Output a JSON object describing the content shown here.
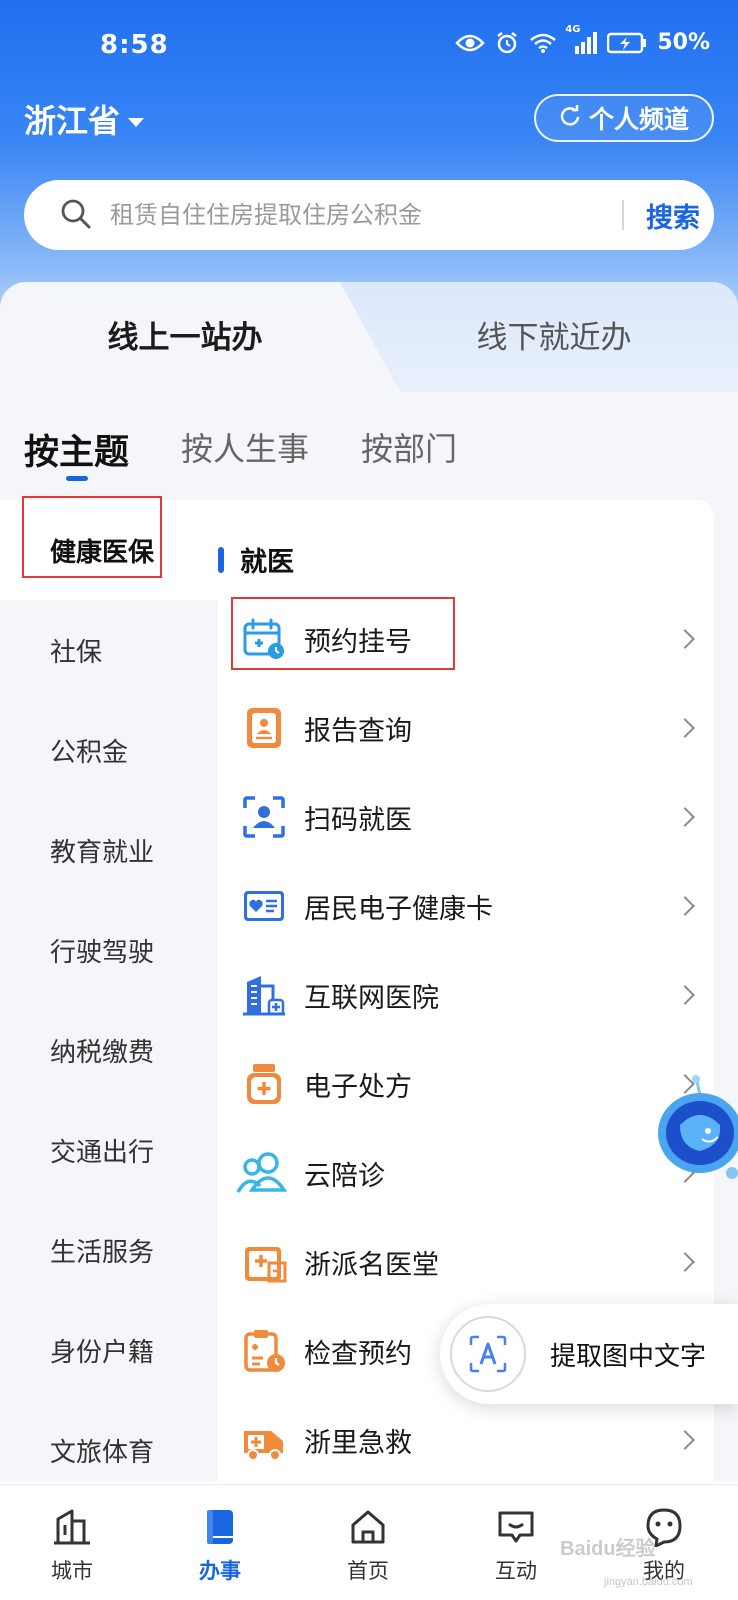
{
  "status_bar": {
    "time": "8:58",
    "network": "4G",
    "battery": "50%"
  },
  "header": {
    "province": "浙江省",
    "personal_channel": "个人频道"
  },
  "search": {
    "placeholder": "租赁自住住房提取住房公积金",
    "button": "搜索"
  },
  "mode_tabs": {
    "online": "线上一站办",
    "offline": "线下就近办",
    "selected": "线上一站办"
  },
  "sub_tabs": {
    "items": [
      "按主题",
      "按人生事",
      "按部门"
    ],
    "selected": "按主题"
  },
  "side_nav": {
    "items": [
      "健康医保",
      "社保",
      "公积金",
      "教育就业",
      "行驶驾驶",
      "纳税缴费",
      "交通出行",
      "生活服务",
      "身份户籍",
      "文旅体育"
    ],
    "selected": "健康医保"
  },
  "section": {
    "title": "就医"
  },
  "services": [
    {
      "label": "预约挂号",
      "icon": "calendar-plus-icon",
      "color": "#2a9be8"
    },
    {
      "label": "报告查询",
      "icon": "report-icon",
      "color": "#f08a3c"
    },
    {
      "label": "扫码就医",
      "icon": "scan-person-icon",
      "color": "#2f6fe0"
    },
    {
      "label": "居民电子健康卡",
      "icon": "health-card-icon",
      "color": "#2f6fe0"
    },
    {
      "label": "互联网医院",
      "icon": "hospital-building-icon",
      "color": "#2f6fe0"
    },
    {
      "label": "电子处方",
      "icon": "medicine-bottle-icon",
      "color": "#f08a3c"
    },
    {
      "label": "云陪诊",
      "icon": "people-icon",
      "color": "#39b5e6"
    },
    {
      "label": "浙派名医堂",
      "icon": "clinic-icon",
      "color": "#f08a3c"
    },
    {
      "label": "检查预约",
      "icon": "clipboard-clock-icon",
      "color": "#f08a3c"
    },
    {
      "label": "浙里急救",
      "icon": "ambulance-icon",
      "color": "#f08a3c"
    }
  ],
  "floating": {
    "ocr_label": "提取图中文字"
  },
  "bottom_nav": {
    "items": [
      "城市",
      "办事",
      "首页",
      "互动",
      "我的"
    ],
    "selected": "办事"
  },
  "watermark": {
    "text": "Baidu经验",
    "sub": "jingyan.baidu.com"
  },
  "colors": {
    "brand_blue": "#1a66e0",
    "highlight_red": "#e53935",
    "icon_orange": "#f08a3c"
  }
}
